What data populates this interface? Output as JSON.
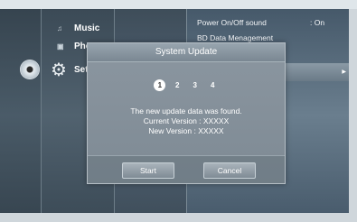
{
  "menu": {
    "items": [
      {
        "label": "Music",
        "icon": "music-note-icon"
      },
      {
        "label": "Pho",
        "icon": "photo-icon"
      },
      {
        "label": "Set",
        "icon": "gear-icon"
      }
    ]
  },
  "settings": {
    "rows": [
      {
        "label": "Power On/Off sound",
        "value": ": On"
      },
      {
        "label": "BD Data Menagement",
        "value": ""
      }
    ],
    "arrow": "▶"
  },
  "dialog": {
    "title": "System Update",
    "steps": [
      "1",
      "2",
      "3",
      "4"
    ],
    "active_step": 1,
    "message_line1": "The new update data was found.",
    "message_line2": "Current Version : XXXXX",
    "message_line3": "New Version : XXXXX",
    "start_label": "Start",
    "cancel_label": "Cancel"
  }
}
